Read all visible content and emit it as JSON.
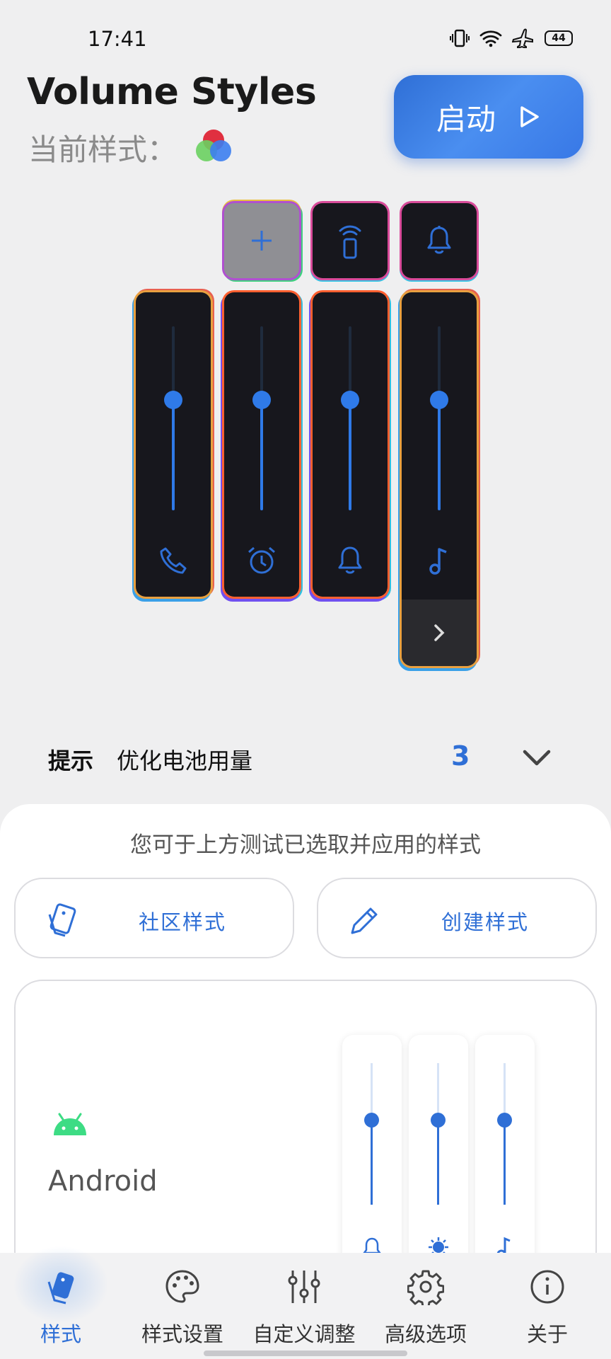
{
  "status_bar": {
    "time": "17:41",
    "battery": "44"
  },
  "header": {
    "title": "Volume Styles",
    "current_style_label": "当前样式：",
    "start_button_label": "启动"
  },
  "preview": {
    "top_buttons": [
      {
        "icon": "plus-icon"
      },
      {
        "icon": "cast-remote-icon"
      },
      {
        "icon": "bell-icon"
      }
    ],
    "sliders": [
      {
        "icon": "phone-icon",
        "level": 0.6
      },
      {
        "icon": "alarm-icon",
        "level": 0.6
      },
      {
        "icon": "bell-icon",
        "level": 0.6
      },
      {
        "icon": "music-note-icon",
        "level": 0.6
      }
    ]
  },
  "tip": {
    "label": "提示",
    "text": "优化电池用量",
    "count": "3"
  },
  "sheet": {
    "hint": "您可于上方测试已选取并应用的样式",
    "community_label": "社区样式",
    "create_label": "创建样式",
    "style_card": {
      "name": "Android",
      "mini_sliders": [
        {
          "icon": "bell-icon",
          "level": 0.6
        },
        {
          "icon": "brightness-icon",
          "level": 0.6
        },
        {
          "icon": "music-note-icon",
          "level": 0.6
        }
      ]
    }
  },
  "bottom_nav": {
    "items": [
      {
        "label": "样式",
        "icon": "style-cards-icon",
        "active": true
      },
      {
        "label": "样式设置",
        "icon": "palette-icon",
        "active": false
      },
      {
        "label": "自定义调整",
        "icon": "sliders-icon",
        "active": false
      },
      {
        "label": "高级选项",
        "icon": "gear-icon",
        "active": false
      },
      {
        "label": "关于",
        "icon": "info-icon",
        "active": false
      }
    ]
  },
  "colors": {
    "accent": "#2f6fd6",
    "android_green": "#3ddc84",
    "panel_dark": "#17171d"
  }
}
